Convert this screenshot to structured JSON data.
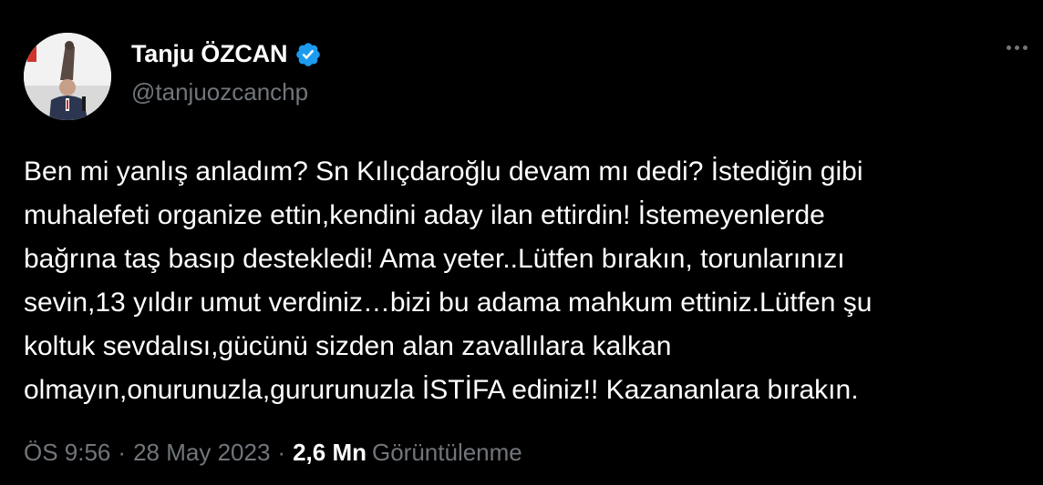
{
  "user": {
    "display_name": "Tanju ÖZCAN",
    "handle": "@tanjuozcanchp",
    "verified": true,
    "avatar_icon": "profile-photo"
  },
  "tweet": {
    "lines": [
      "Ben mi yanlış anladım? Sn Kılıçdaroğlu devam mı dedi? İstediğin gibi",
      "muhalefeti organize ettin,kendini aday ilan ettirdin! İstemeyenlerde",
      "bağrına taş basıp destekledi! Ama yeter..Lütfen bırakın, torunlarınızı",
      "sevin,13 yıldır umut verdiniz…bizi bu adama mahkum ettiniz.Lütfen şu",
      "koltuk sevdalısı,gücünü sizden alan zavallılara kalkan",
      "olmayın,onurunuzla,gururunuzla İSTİFA ediniz!! Kazananlara bırakın."
    ]
  },
  "meta": {
    "time": "ÖS 9:56",
    "separator": "·",
    "date": "28 May 2023",
    "views_count": "2,6 Mn",
    "views_label": "Görüntülenme"
  },
  "icons": {
    "verified": "verified-badge-icon",
    "more": "more-options-icon"
  },
  "colors": {
    "background": "#000000",
    "text_primary": "#ffffff",
    "text_secondary": "#71767b",
    "verified_blue": "#1d9bf0"
  }
}
